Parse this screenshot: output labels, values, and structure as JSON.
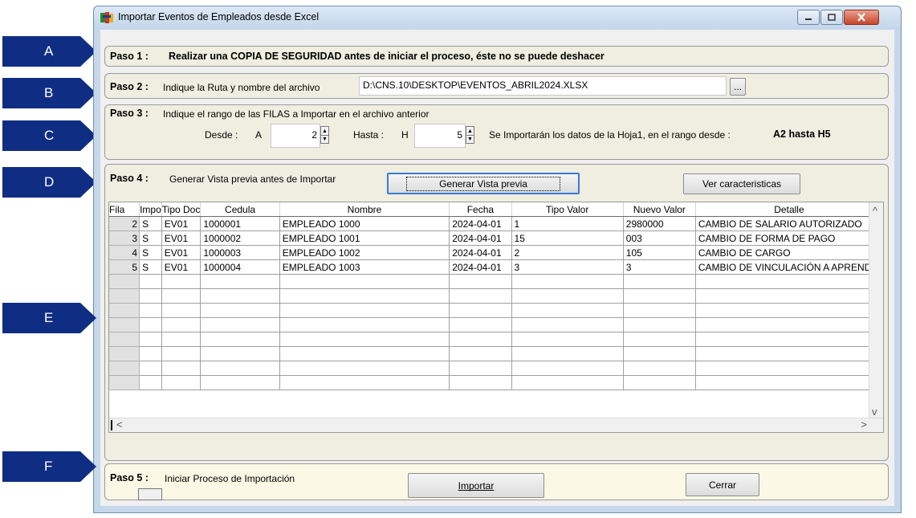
{
  "window": {
    "title": "Importar Eventos de Empleados desde Excel"
  },
  "callouts": [
    "A",
    "B",
    "C",
    "D",
    "E",
    "F"
  ],
  "step1": {
    "label": "Paso 1 :",
    "text": "Realizar una COPIA DE SEGURIDAD antes de iniciar el proceso, éste no se puede deshacer"
  },
  "step2": {
    "label": "Paso 2 :",
    "text": "Indique la Ruta y nombre del archivo",
    "path": "D:\\CNS.10\\DESKTOP\\EVENTOS_ABRIL2024.XLSX",
    "browse_label": "..."
  },
  "step3": {
    "label": "Paso 3 :",
    "text": "Indique el rango de las FILAS a Importar en el archivo anterior",
    "desde_label": "Desde :",
    "desde_col": "A",
    "desde_value": "2",
    "hasta_label": "Hasta :",
    "hasta_col": "H",
    "hasta_value": "5",
    "info_text": "Se Importarán los datos de la Hoja1,  en el rango desde :",
    "info_range": "A2 hasta H5"
  },
  "step4": {
    "label": "Paso 4 :",
    "text": "Generar Vista previa antes de Importar",
    "preview_button": "Generar Vista previa",
    "features_button": "Ver caracteristicas"
  },
  "grid": {
    "headers": [
      "Fila",
      "Impo",
      "Tipo Doc",
      "Cedula",
      "Nombre",
      "Fecha",
      "Tipo Valor",
      "Nuevo Valor",
      "Detalle"
    ],
    "rows": [
      [
        "2",
        "S",
        "EV01",
        "1000001",
        "EMPLEADO 1000",
        "2024-04-01",
        "1",
        "2980000",
        "CAMBIO DE SALARIO AUTORIZADO"
      ],
      [
        "3",
        "S",
        "EV01",
        "1000002",
        "EMPLEADO 1001",
        "2024-04-01",
        "15",
        "003",
        "CAMBIO DE FORMA DE PAGO"
      ],
      [
        "4",
        "S",
        "EV01",
        "1000003",
        "EMPLEADO 1002",
        "2024-04-01",
        "2",
        "105",
        "CAMBIO DE CARGO"
      ],
      [
        "5",
        "S",
        "EV01",
        "1000004",
        "EMPLEADO 1003",
        "2024-04-01",
        "3",
        "3",
        "CAMBIO DE VINCULACIÓN A APRENDIZ"
      ]
    ]
  },
  "step5": {
    "label": "Paso 5 :",
    "text": "Iniciar Proceso de Importación",
    "import_button": "Importar",
    "close_button": "Cerrar"
  }
}
